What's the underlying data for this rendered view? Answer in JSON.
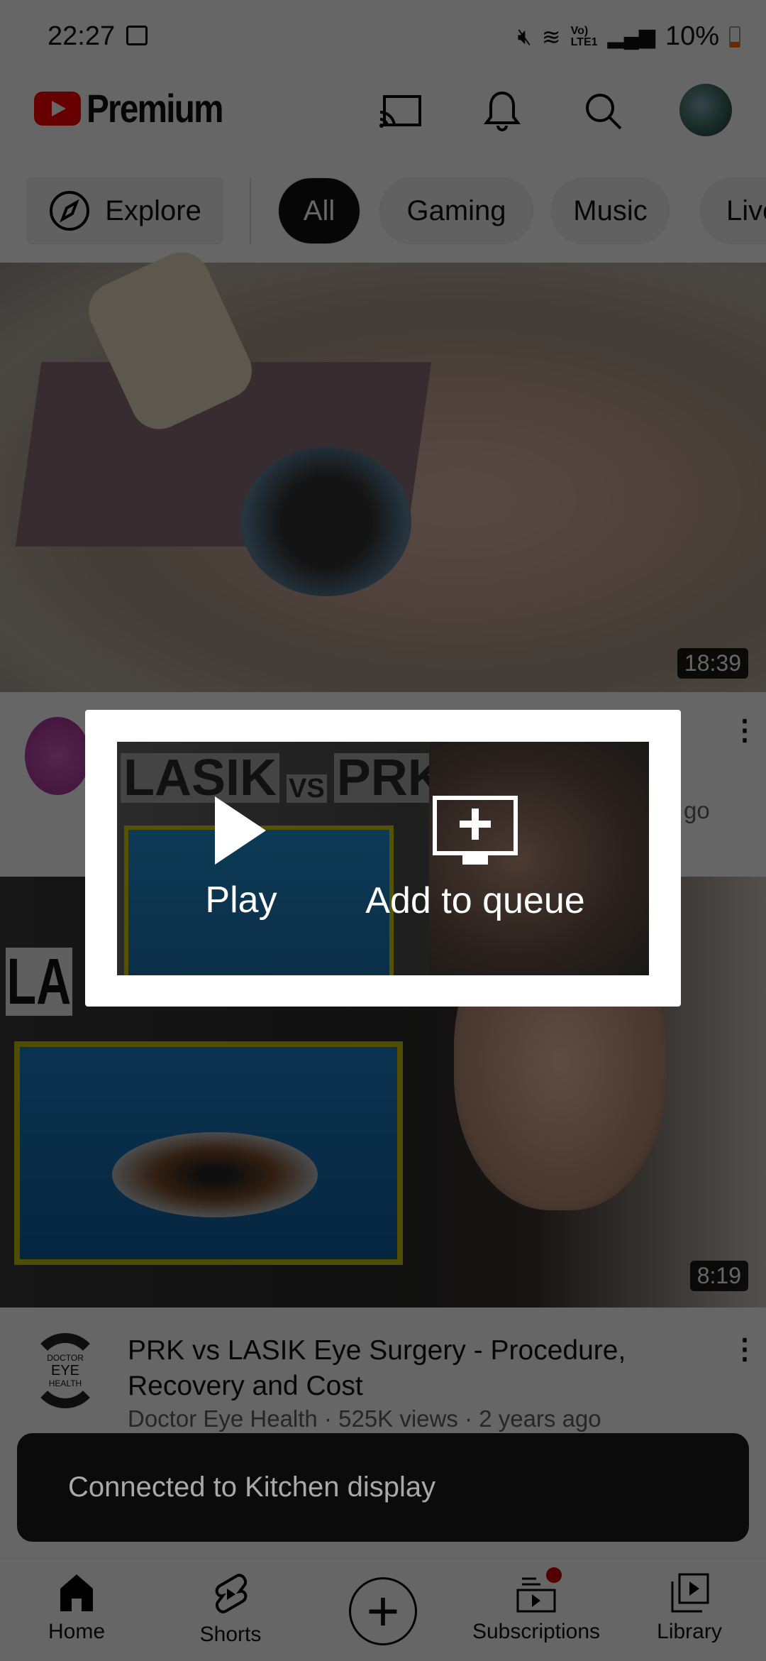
{
  "status_bar": {
    "time": "22:27",
    "battery": "10%",
    "icons": [
      "gallery-icon",
      "mute-icon",
      "wifi-icon",
      "volte-icon",
      "signal-icon",
      "battery-icon"
    ]
  },
  "header": {
    "brand": "Premium",
    "icons": [
      "cast-icon",
      "bell-icon",
      "search-icon",
      "avatar"
    ]
  },
  "chips": {
    "explore": "Explore",
    "items": [
      "All",
      "Gaming",
      "Music",
      "Live"
    ],
    "selected": "All"
  },
  "videos": [
    {
      "duration": "18:39",
      "meta_fragment": "go"
    },
    {
      "duration": "8:19",
      "title": "PRK vs LASIK Eye Surgery - Procedure, Recovery and Cost",
      "meta": "Doctor Eye Health · 525K views · 2 years ago",
      "channel_logo": [
        "DOCTOR",
        "EYE",
        "HEALTH"
      ],
      "thumb_text": "LA"
    }
  ],
  "dialog": {
    "thumb_text": {
      "a": "LASIK",
      "vs": "VS",
      "b": "PRK"
    },
    "play": "Play",
    "queue": "Add to queue"
  },
  "toast": {
    "message": "Connected to Kitchen display"
  },
  "nav": {
    "items": [
      "Home",
      "Shorts",
      "",
      "Subscriptions",
      "Library"
    ]
  },
  "colors": {
    "brand_red": "#ff0000",
    "notification_dot": "#cc0000"
  }
}
